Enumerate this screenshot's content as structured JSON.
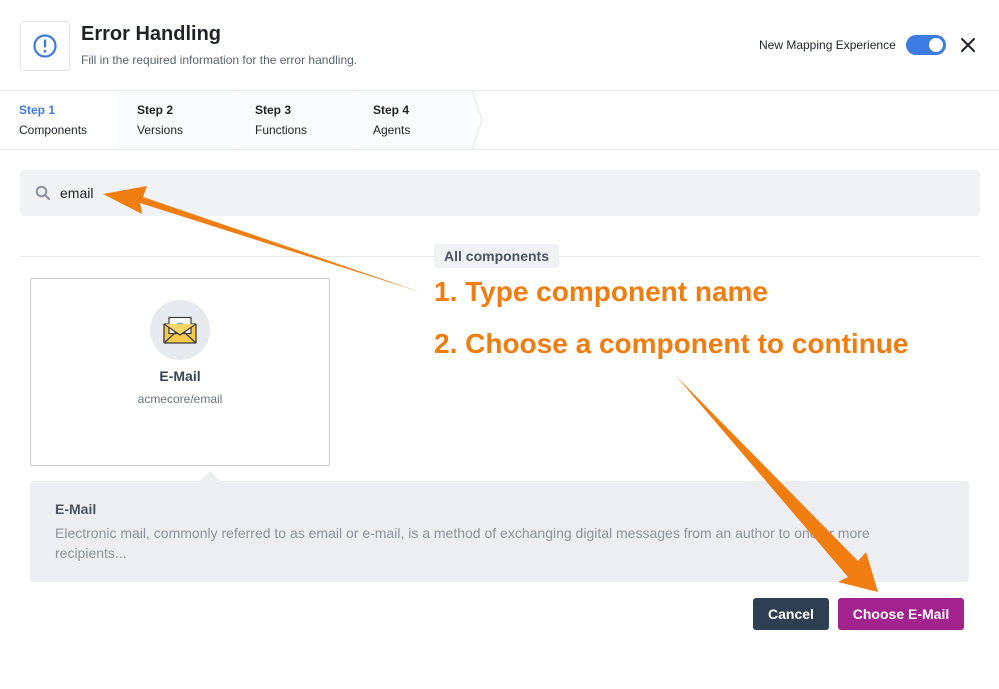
{
  "header": {
    "title": "Error Handling",
    "subtitle": "Fill in the required information for the error handling.",
    "toggle_label": "New Mapping Experience",
    "toggle_on": true
  },
  "steps": [
    {
      "num": "Step 1",
      "name": "Components",
      "active": true
    },
    {
      "num": "Step 2",
      "name": "Versions",
      "active": false
    },
    {
      "num": "Step 3",
      "name": "Functions",
      "active": false
    },
    {
      "num": "Step 4",
      "name": "Agents",
      "active": false
    }
  ],
  "search": {
    "value": "email"
  },
  "section_label": "All components",
  "card": {
    "name": "E-Mail",
    "path": "acmecore/email",
    "icon": "email-envelope-icon"
  },
  "description": {
    "title": "E-Mail",
    "text": "Electronic mail, commonly referred to as email or e-mail, is a method of exchanging digital messages from an author to one or more recipients..."
  },
  "buttons": {
    "cancel": "Cancel",
    "choose": "Choose E-Mail"
  },
  "annotations": {
    "note1": "1. Type component name",
    "note2": "2. Choose a component to continue"
  },
  "colors": {
    "accent": "#3d7be0",
    "primary_button": "#a3238e",
    "secondary_button": "#2f3f52",
    "annotation": "#f07d10"
  }
}
